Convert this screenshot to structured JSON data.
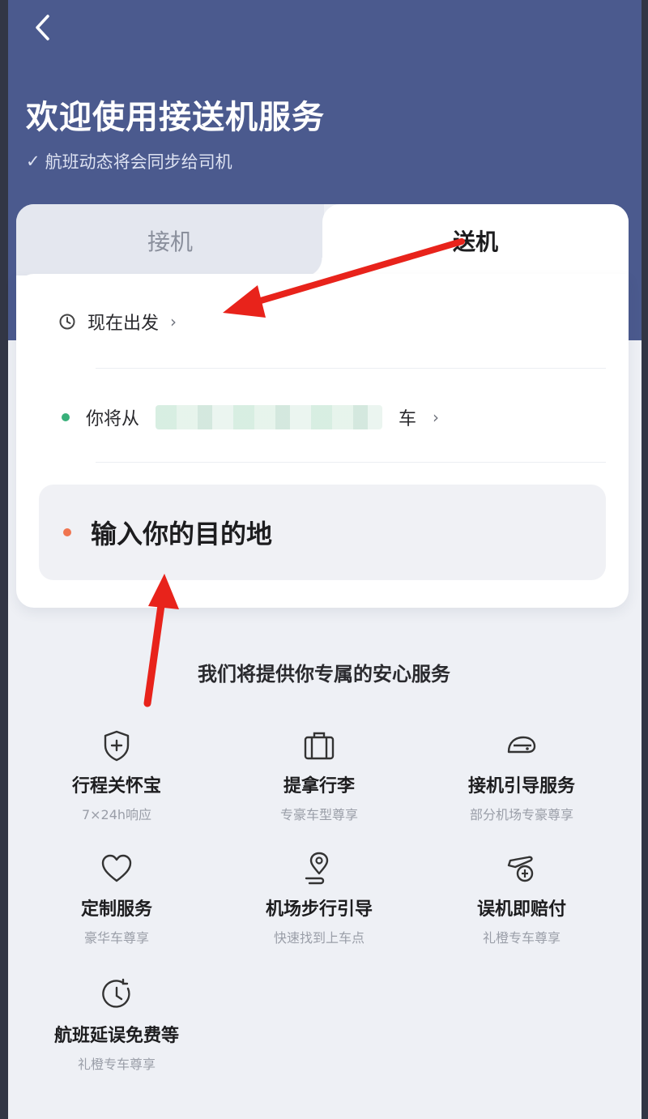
{
  "header": {
    "title": "欢迎使用接送机服务",
    "subtitle": "航班动态将会同步给司机"
  },
  "tabs": [
    {
      "label": "接机"
    },
    {
      "label": "送机"
    }
  ],
  "active_tab": "送机",
  "trip": {
    "depart_time": "现在出发",
    "from_prefix": "你将从",
    "from_suffix": "车",
    "destination_placeholder": "输入你的目的地"
  },
  "services": {
    "title": "我们将提供你专属的安心服务",
    "items": [
      {
        "name": "行程关怀宝",
        "desc": "7×24h响应",
        "icon": "shield-plus-icon"
      },
      {
        "name": "提拿行李",
        "desc": "专豪车型尊享",
        "icon": "luggage-icon"
      },
      {
        "name": "接机引导服务",
        "desc": "部分机场专豪尊享",
        "icon": "guide-icon"
      },
      {
        "name": "定制服务",
        "desc": "豪华车尊享",
        "icon": "heart-icon"
      },
      {
        "name": "机场步行引导",
        "desc": "快速找到上车点",
        "icon": "location-walk-icon"
      },
      {
        "name": "误机即赔付",
        "desc": "礼橙专车尊享",
        "icon": "plane-compensation-icon"
      },
      {
        "name": "航班延误免费等",
        "desc": "礼橙专车尊享",
        "icon": "clock-wait-icon"
      }
    ]
  },
  "colors": {
    "header_bg": "#4b5a8e",
    "annotation_arrow": "#e8231b",
    "origin_dot": "#38b07a",
    "destination_dot": "#f07550"
  }
}
